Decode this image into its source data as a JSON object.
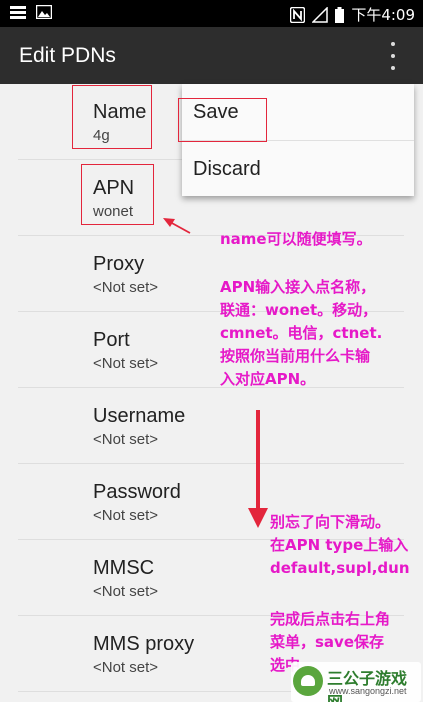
{
  "status_bar": {
    "nfc_icon": "nfc-icon",
    "signal_icon": "signal-icon",
    "battery_icon": "battery-icon",
    "time": "下午4:09"
  },
  "action_bar": {
    "title": "Edit PDNs",
    "overflow_icon": "more-vert-icon"
  },
  "prefs": [
    {
      "title": "Name",
      "summary": "4g"
    },
    {
      "title": "APN",
      "summary": "wonet"
    },
    {
      "title": "Proxy",
      "summary": "<Not set>"
    },
    {
      "title": "Port",
      "summary": "<Not set>"
    },
    {
      "title": "Username",
      "summary": "<Not set>"
    },
    {
      "title": "Password",
      "summary": "<Not set>"
    },
    {
      "title": "MMSC",
      "summary": "<Not set>"
    },
    {
      "title": "MMS proxy",
      "summary": "<Not set>"
    }
  ],
  "menu": {
    "save": "Save",
    "discard": "Discard"
  },
  "annotations": {
    "note1": "name可以随便填写。",
    "note2": "APN输入接入点名称，\n联通：wonet。移动，\ncmnet。电信，ctnet.\n按照你当前用什么卡输\n入对应APN。",
    "note3": "别忘了向下滑动。\n在APN type上输入\ndefault,supl,dun",
    "note4": "完成后点击右上角\n菜单，save保存\n选中"
  },
  "watermark": {
    "name": "三公子游戏网",
    "url": "www.sangongzi.net"
  },
  "colors": {
    "annotation_text": "#e619c8",
    "annotation_box": "#e3263c",
    "action_bar": "#2d2d2d"
  }
}
